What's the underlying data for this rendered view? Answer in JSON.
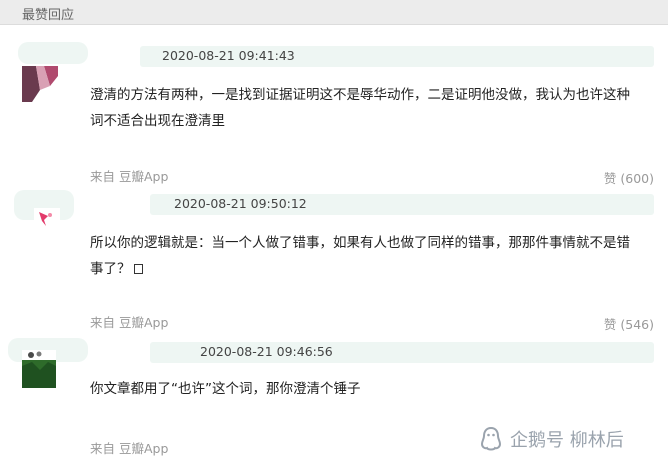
{
  "section": {
    "title": "最赞回应"
  },
  "comments": [
    {
      "timestamp": "2020-08-21 09:41:43",
      "text_lines": [
        "澄清的方法有两种，一是找到证据证明这不是辱华动作，二是证明他没做，我认为也许这种",
        "词不适合出现在澄清里"
      ],
      "source": "来自 豆瓣App",
      "likes": "赞 (600)"
    },
    {
      "timestamp": "2020-08-21 09:50:12",
      "text_lines": [
        "所以你的逻辑就是：当一个人做了错事，如果有人也做了同样的错事，那那件事情就不是错",
        "事了？"
      ],
      "source": "来自 豆瓣App",
      "likes": "赞 (546)"
    },
    {
      "timestamp": "2020-08-21 09:46:56",
      "text_lines": [
        "你文章都用了“也许”这个词，那你澄清个锤子"
      ],
      "source": "来自 豆瓣App"
    }
  ],
  "watermark": {
    "text": "企鹅号 柳林后"
  },
  "colors": {
    "meta_bar": "#eef6f3",
    "header_bg": "#ececec",
    "muted": "#999999",
    "watermark": "#9aa3ad"
  }
}
